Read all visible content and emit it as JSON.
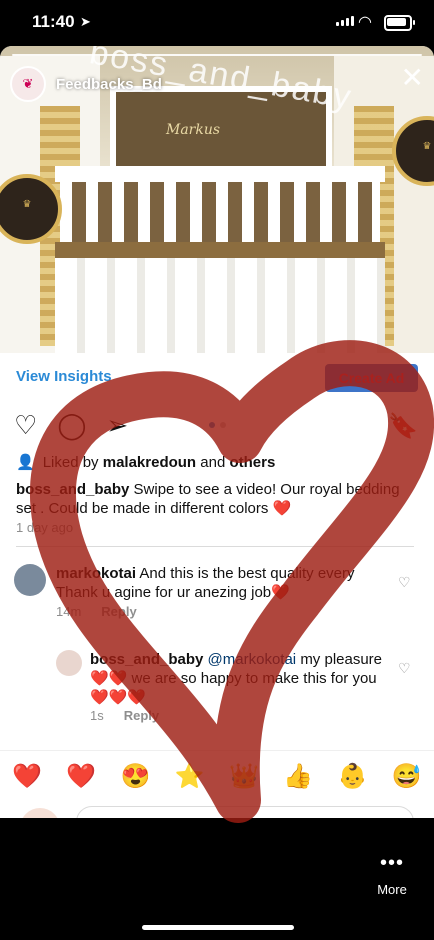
{
  "status": {
    "time": "11:40"
  },
  "story": {
    "username": "Feedbacks_Bd",
    "watermark": "boss_and_baby",
    "monogram": "Markus"
  },
  "insights": {
    "view_label": "View Insights",
    "create_ad_label": "Create Ad"
  },
  "post": {
    "liked_prefix": "Liked by",
    "liked_user": "malakredoun",
    "liked_and": "and",
    "liked_others": "others",
    "caption_user": "boss_and_baby",
    "caption_text": "Swipe to see a video! Our royal bedding set . Could be made in different colors ❤️",
    "time_ago": "1 day ago"
  },
  "comments": [
    {
      "user": "markokotai",
      "text": "And this is the best quality every Thank u agine for ur anezing job❤️",
      "time": "14m",
      "reply": "Reply"
    },
    {
      "user": "boss_and_baby",
      "mention": "@markokotai",
      "text": "my pleasure ❤️❤️ we are so happy to make this for you❤️❤️❤️",
      "time": "1s",
      "reply": "Reply"
    }
  ],
  "reactions": [
    "❤️",
    "❤️",
    "😍",
    "⭐",
    "👑",
    "👍",
    "👶",
    "😅"
  ],
  "bottom": {
    "more_label": "More"
  },
  "colors": {
    "accent": "#2b8ad6",
    "drawn_heart": "#9e1d12"
  }
}
